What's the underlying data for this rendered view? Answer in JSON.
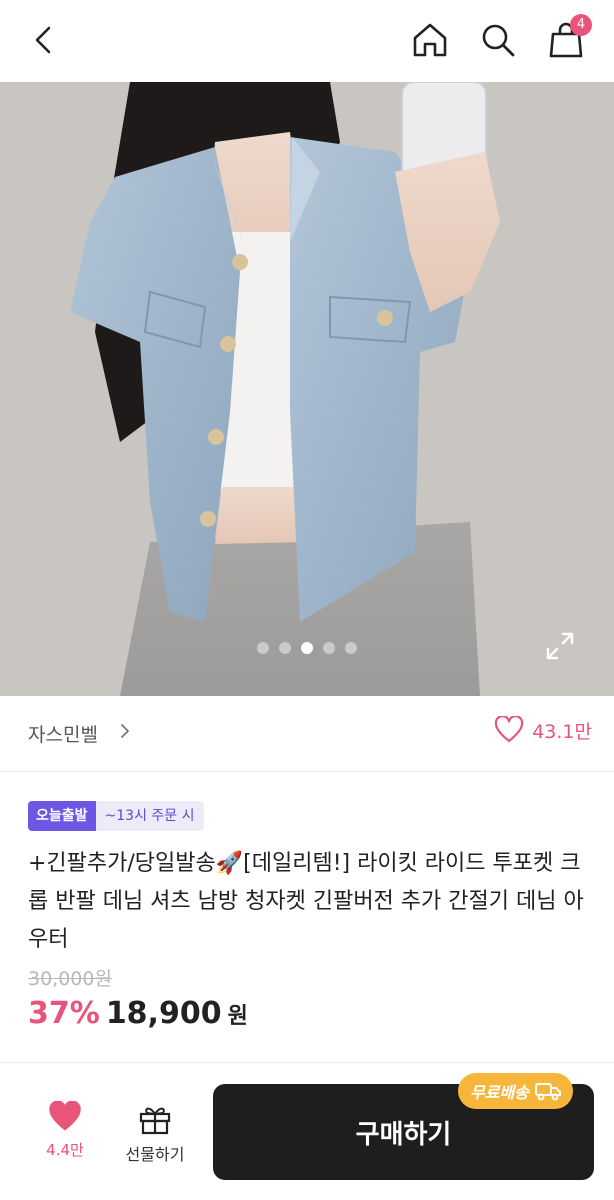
{
  "header": {
    "icons": [
      "chevron-left-icon",
      "home-icon",
      "search-icon",
      "shopping-bag-icon"
    ],
    "cart_count": "4"
  },
  "gallery": {
    "slide_count": 5,
    "active_index": 2
  },
  "shop": {
    "name": "자스민벨",
    "like_count": "43.1만"
  },
  "product": {
    "badge_today": "오늘출발",
    "badge_time": "~13시 주문 시",
    "title": "+긴팔추가/당일발송🚀[데일리템!] 라이킷 라이드 투포켓 크롭 반팔 데님 셔츠 남방 청자켓 긴팔버전 추가 간절기 데님 아우터",
    "original_price": "30,000원",
    "discount": "37%",
    "price": "18,900",
    "currency": "원"
  },
  "bottom_bar": {
    "wish_count": "4.4만",
    "gift_label": "선물하기",
    "buy_label": "구매하기",
    "free_shipping_label": "무료배송"
  },
  "colors": {
    "accent_pink": "#e9547a",
    "badge_purple": "#6b57e3",
    "shipping_orange": "#f6b53b",
    "buy_button": "#1e1e1e"
  }
}
